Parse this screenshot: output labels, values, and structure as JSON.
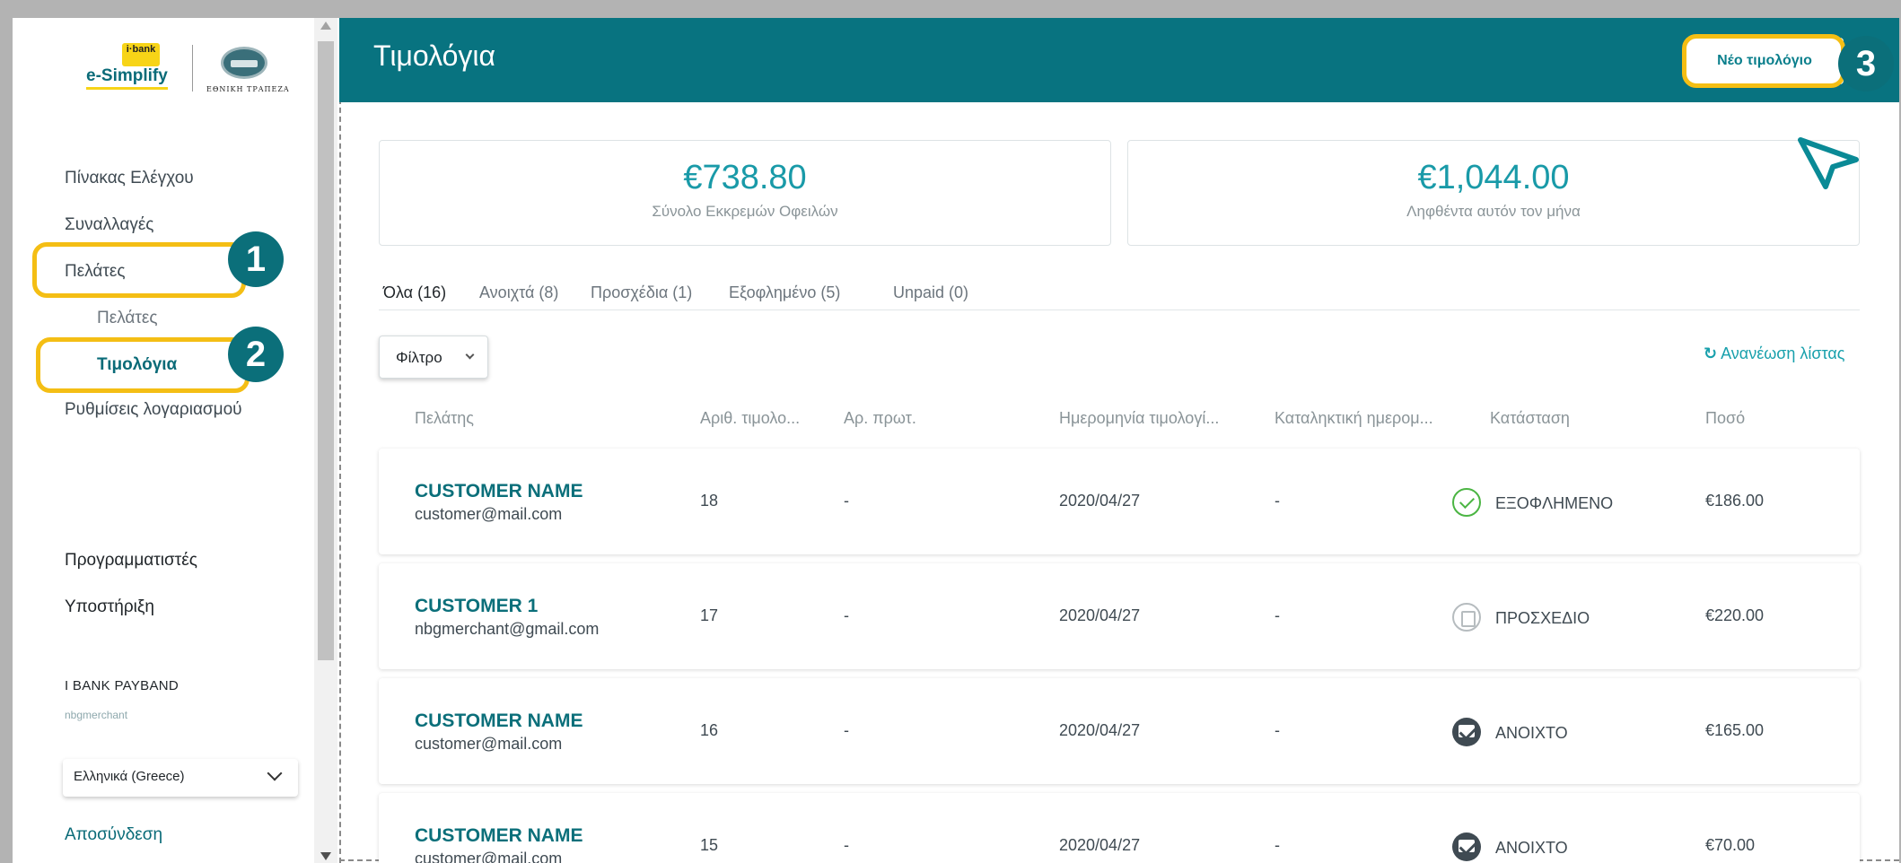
{
  "logo": {
    "ibank": "i·bank",
    "product": "e-Simplify",
    "bank": "ΕΘΝΙΚΗ ΤΡΑΠΕΖΑ"
  },
  "sidebar": {
    "items": [
      {
        "label": "Πίνακας Ελέγχου"
      },
      {
        "label": "Συναλλαγές"
      },
      {
        "label": "Πελάτες"
      },
      {
        "label": "Πελάτες"
      },
      {
        "label": "Τιμολόγια"
      },
      {
        "label": "Ρυθμίσεις λογαριασμού"
      }
    ],
    "developers": "Προγραμματιστές",
    "support": "Υποστήριξη",
    "account_name": "I BANK PAYBAND",
    "account_user": "nbgmerchant",
    "language": "Ελληνικά (Greece)",
    "logout": "Αποσύνδεση"
  },
  "annotations": {
    "badge1": "1",
    "badge2": "2",
    "badge3": "3",
    "highlight_color": "#f4be14",
    "badge_color": "#0b6f7a"
  },
  "header": {
    "title": "Τιμολόγια",
    "new_invoice": "Νέο τιμολόγιο",
    "color": "#087380"
  },
  "stats": {
    "outstanding_value": "€738.80",
    "outstanding_label": "Σύνολο Εκκρεμών Οφειλών",
    "received_value": "€1,044.00",
    "received_label": "Ληφθέντα αυτόν τον μήνα"
  },
  "tabs": [
    {
      "label": "Όλα (16)"
    },
    {
      "label": "Ανοιχτά (8)"
    },
    {
      "label": "Προσχέδια (1)"
    },
    {
      "label": "Εξοφλημένο (5)"
    },
    {
      "label": "Unpaid (0)"
    }
  ],
  "filter_label": "Φίλτρο",
  "refresh_label": "Ανανέωση λίστας",
  "refresh_icon": "refresh-icon",
  "table": {
    "columns": [
      "Πελάτης",
      "Αριθ. τιμολο...",
      "Αρ. πρωτ.",
      "Ημερομηνία τιμολογί...",
      "Καταληκτική ημερομ...",
      "Κατάσταση",
      "Ποσό"
    ],
    "rows": [
      {
        "name": "CUSTOMER NAME",
        "email": "customer@mail.com",
        "number": "18",
        "protocol": "-",
        "date": "2020/04/27",
        "due": "-",
        "status": "ΕΞΟΦΛΗΜΕΝΟ",
        "status_icon": "check-circle-icon",
        "amount": "€186.00"
      },
      {
        "name": "CUSTOMER 1",
        "email": "nbgmerchant@gmail.com",
        "number": "17",
        "protocol": "-",
        "date": "2020/04/27",
        "due": "-",
        "status": "ΠΡΟΣΧΕΔΙΟ",
        "status_icon": "draft-doc-icon",
        "amount": "€220.00"
      },
      {
        "name": "CUSTOMER NAME",
        "email": "customer@mail.com",
        "number": "16",
        "protocol": "-",
        "date": "2020/04/27",
        "due": "-",
        "status": "ΑΝΟΙΧΤΟ",
        "status_icon": "open-envelope-icon",
        "amount": "€165.00"
      },
      {
        "name": "CUSTOMER NAME",
        "email": "customer@mail.com",
        "number": "15",
        "protocol": "-",
        "date": "2020/04/27",
        "due": "-",
        "status": "ΑΝΟΙΧΤΟ",
        "status_icon": "open-envelope-icon",
        "amount": "€70.00"
      }
    ]
  }
}
